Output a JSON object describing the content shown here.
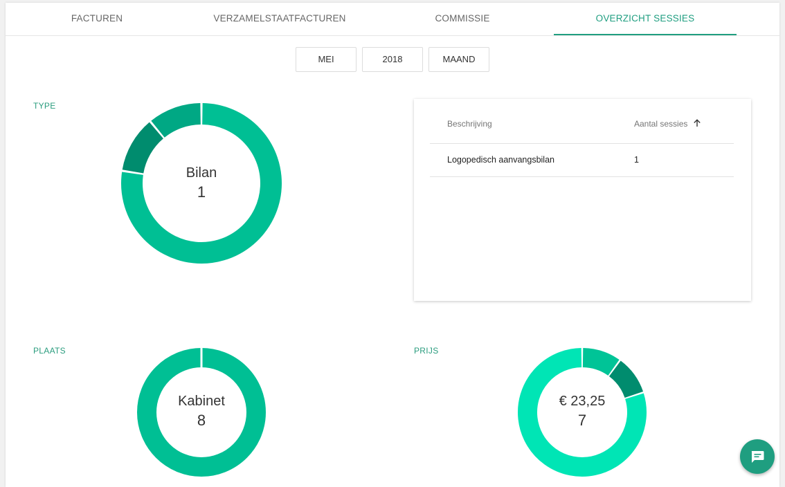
{
  "tabs": [
    {
      "label": "FACTUREN",
      "active": false
    },
    {
      "label": "VERZAMELSTAATFACTUREN",
      "active": false
    },
    {
      "label": "COMMISSIE",
      "active": false
    },
    {
      "label": "OVERZICHT SESSIES",
      "active": true
    }
  ],
  "filters": {
    "month": "MEI",
    "year": "2018",
    "period": "MAAND"
  },
  "sections": {
    "type_label": "TYPE",
    "plaats_label": "PLAATS",
    "prijs_label": "PRIJS"
  },
  "type_chart": {
    "center_label": "Bilan",
    "center_value": "1",
    "slices": [
      {
        "value": 0.775,
        "color": "#00bf94"
      },
      {
        "value": 0.115,
        "color": "#008c6e"
      },
      {
        "value": 0.11,
        "color": "#00a884"
      }
    ]
  },
  "plaats_chart": {
    "center_label": "Kabinet",
    "center_value": "8",
    "slices": [
      {
        "value": 1.0,
        "color": "#00bf94"
      }
    ]
  },
  "prijs_chart": {
    "center_label": "€ 23,25",
    "center_value": "7",
    "slices": [
      {
        "value": 0.1,
        "color": "#00c497"
      },
      {
        "value": 0.1,
        "color": "#008c6e"
      },
      {
        "value": 0.8,
        "color": "#00e5b5"
      }
    ]
  },
  "table": {
    "columns": [
      "Beschrijving",
      "Aantal sessies"
    ],
    "rows": [
      [
        "Logopedisch aanvangsbilan",
        "1"
      ]
    ]
  },
  "icons": {
    "sort": "arrow-up-icon",
    "fab": "chat-icon"
  },
  "colors": {
    "accent": "#1f9e80"
  }
}
